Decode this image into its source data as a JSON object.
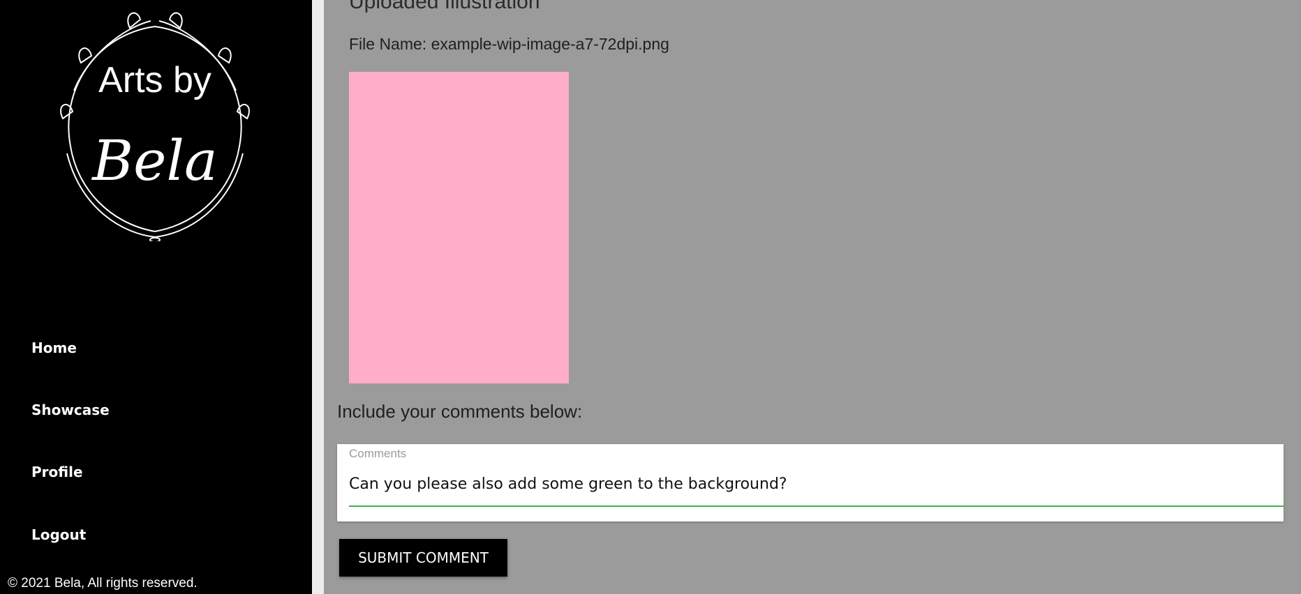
{
  "brand": {
    "logo_line1": "Arts by",
    "logo_line2": "Bela",
    "logo_icon": "laurel-wreath-icon"
  },
  "sidebar": {
    "items": [
      {
        "label": "Home"
      },
      {
        "label": "Showcase"
      },
      {
        "label": "Profile"
      },
      {
        "label": "Logout"
      }
    ],
    "footer": "© 2021 Bela, All rights reserved."
  },
  "main": {
    "section_title": "Uploaded Illustration",
    "file_name": "File Name: example-wip-image-a7-72dpi.png",
    "illustration_color": "#ffadc8",
    "comments_heading": "Include your comments below:",
    "comment_field": {
      "label": "Comments",
      "value": "Can you please also add some green to the background?"
    },
    "submit_label": "SUBMIT COMMENT"
  },
  "colors": {
    "sidebar_bg": "#000000",
    "page_bg": "#9b9b9b",
    "accent": "#4caf50"
  }
}
